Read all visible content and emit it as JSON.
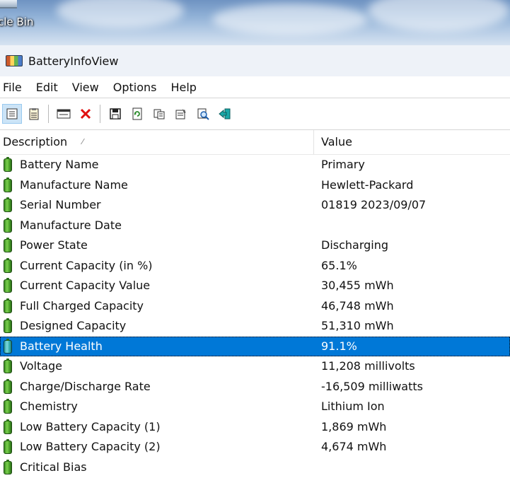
{
  "desktop": {
    "recycle_bin_label": "cle Bin"
  },
  "window": {
    "title": "BatteryInfoView"
  },
  "menu": [
    "File",
    "Edit",
    "View",
    "Options",
    "Help"
  ],
  "toolbar": {
    "buttons": [
      {
        "name": "view-details-icon",
        "glyph": "▤"
      },
      {
        "name": "view-list-icon",
        "glyph": "▥"
      },
      {
        "name": "window-icon",
        "glyph": "▭"
      },
      {
        "name": "close-x-icon",
        "glyph": "✕"
      },
      {
        "name": "save-icon",
        "glyph": "💾"
      },
      {
        "name": "refresh-icon",
        "glyph": "⟳"
      },
      {
        "name": "copy-icon",
        "glyph": "⧉"
      },
      {
        "name": "properties-icon",
        "glyph": "☑"
      },
      {
        "name": "search-icon",
        "glyph": "⌕"
      },
      {
        "name": "exit-icon",
        "glyph": "⇥"
      }
    ]
  },
  "columns": {
    "description": "Description",
    "value": "Value"
  },
  "rows": [
    {
      "description": "Battery Name",
      "value": "Primary"
    },
    {
      "description": "Manufacture Name",
      "value": "Hewlett-Packard"
    },
    {
      "description": "Serial Number",
      "value": "01819 2023/09/07"
    },
    {
      "description": "Manufacture Date",
      "value": ""
    },
    {
      "description": "Power State",
      "value": "Discharging"
    },
    {
      "description": "Current Capacity (in %)",
      "value": "65.1%"
    },
    {
      "description": "Current Capacity Value",
      "value": "30,455 mWh"
    },
    {
      "description": "Full Charged Capacity",
      "value": "46,748 mWh"
    },
    {
      "description": "Designed Capacity",
      "value": "51,310 mWh"
    },
    {
      "description": "Battery Health",
      "value": "91.1%"
    },
    {
      "description": "Voltage",
      "value": "11,208 millivolts"
    },
    {
      "description": "Charge/Discharge Rate",
      "value": "-16,509 milliwatts"
    },
    {
      "description": "Chemistry",
      "value": "Lithium Ion"
    },
    {
      "description": "Low Battery Capacity (1)",
      "value": "1,869 mWh"
    },
    {
      "description": "Low Battery Capacity (2)",
      "value": "4,674 mWh"
    },
    {
      "description": "Critical Bias",
      "value": ""
    }
  ],
  "selected_row": 9,
  "colors": {
    "selection": "#0078d7"
  }
}
